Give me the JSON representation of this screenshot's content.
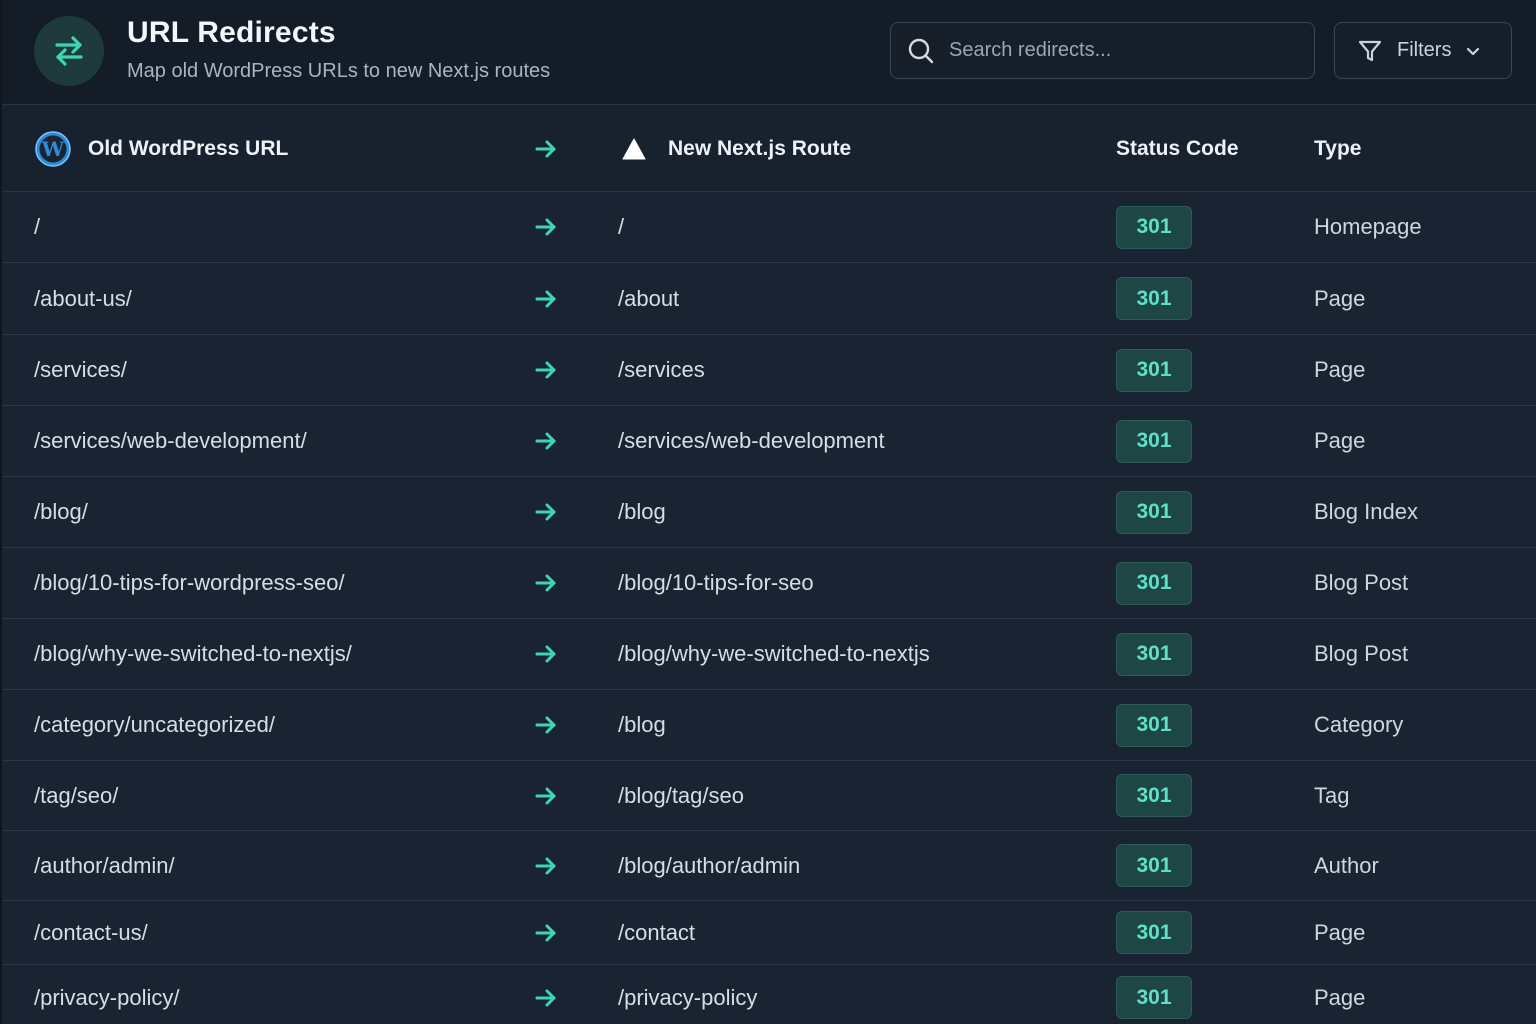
{
  "header": {
    "title": "URL Redirects",
    "subtitle": "Map old WordPress URLs to new Next.js routes",
    "search_placeholder": "Search redirects...",
    "filters_label": "Filters"
  },
  "colors": {
    "accent": "#3dd6b5",
    "badge_bg": "#1d4644",
    "badge_text": "#5fe0c6",
    "background": "#1a2332"
  },
  "table": {
    "columns": {
      "old": "Old WordPress URL",
      "new": "New Next.js Route",
      "status": "Status Code",
      "type": "Type"
    },
    "rows": [
      {
        "old": "/",
        "new": "/",
        "status": "301",
        "type": "Homepage"
      },
      {
        "old": "/about-us/",
        "new": "/about",
        "status": "301",
        "type": "Page"
      },
      {
        "old": "/services/",
        "new": "/services",
        "status": "301",
        "type": "Page"
      },
      {
        "old": "/services/web-development/",
        "new": "/services/web-development",
        "status": "301",
        "type": "Page"
      },
      {
        "old": "/blog/",
        "new": "/blog",
        "status": "301",
        "type": "Blog Index"
      },
      {
        "old": "/blog/10-tips-for-wordpress-seo/",
        "new": "/blog/10-tips-for-seo",
        "status": "301",
        "type": "Blog Post"
      },
      {
        "old": "/blog/why-we-switched-to-nextjs/",
        "new": "/blog/why-we-switched-to-nextjs",
        "status": "301",
        "type": "Blog Post"
      },
      {
        "old": "/category/uncategorized/",
        "new": "/blog",
        "status": "301",
        "type": "Category"
      },
      {
        "old": "/tag/seo/",
        "new": "/blog/tag/seo",
        "status": "301",
        "type": "Tag"
      },
      {
        "old": "/author/admin/",
        "new": "/blog/author/admin",
        "status": "301",
        "type": "Author"
      },
      {
        "old": "/contact-us/",
        "new": "/contact",
        "status": "301",
        "type": "Page"
      },
      {
        "old": "/privacy-policy/",
        "new": "/privacy-policy",
        "status": "301",
        "type": "Page"
      }
    ]
  }
}
